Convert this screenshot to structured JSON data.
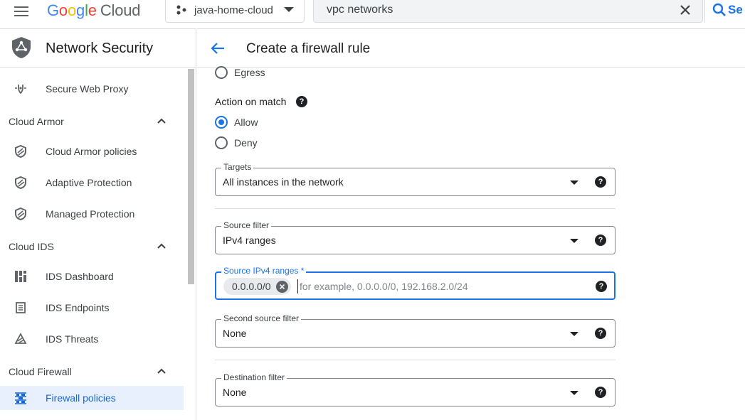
{
  "topbar": {
    "logo_letters": [
      "G",
      "o",
      "o",
      "g",
      "l",
      "e"
    ],
    "logo_cloud": "Cloud",
    "project_name": "java-home-cloud",
    "search_value": "vpc networks",
    "search_button_label": "Se"
  },
  "sidebar": {
    "title": "Network Security",
    "top_item": "Secure Web Proxy",
    "sections": [
      {
        "label": "Cloud Armor",
        "items": [
          "Cloud Armor policies",
          "Adaptive Protection",
          "Managed Protection"
        ]
      },
      {
        "label": "Cloud IDS",
        "items": [
          "IDS Dashboard",
          "IDS Endpoints",
          "IDS Threats"
        ]
      },
      {
        "label": "Cloud Firewall",
        "items": [
          "Firewall policies"
        ]
      }
    ]
  },
  "main": {
    "page_title": "Create a firewall rule",
    "direction_option_egress": "Egress",
    "action_on_match_label": "Action on match",
    "action_allow": "Allow",
    "action_deny": "Deny",
    "targets_label": "Targets",
    "targets_value": "All instances in the network",
    "source_filter_label": "Source filter",
    "source_filter_value": "IPv4 ranges",
    "source_ranges_label": "Source IPv4 ranges *",
    "source_ranges_chip": "0.0.0.0/0",
    "source_ranges_placeholder": "for example, 0.0.0.0/0, 192.168.2.0/24",
    "second_source_label": "Second source filter",
    "second_source_value": "None",
    "destination_filter_label": "Destination filter",
    "destination_filter_value": "None",
    "help_glyph": "?"
  },
  "colors": {
    "accent": "#1a73e8",
    "active_bg": "#e8f0fe",
    "text": "#202124",
    "border": "#dadce0"
  }
}
